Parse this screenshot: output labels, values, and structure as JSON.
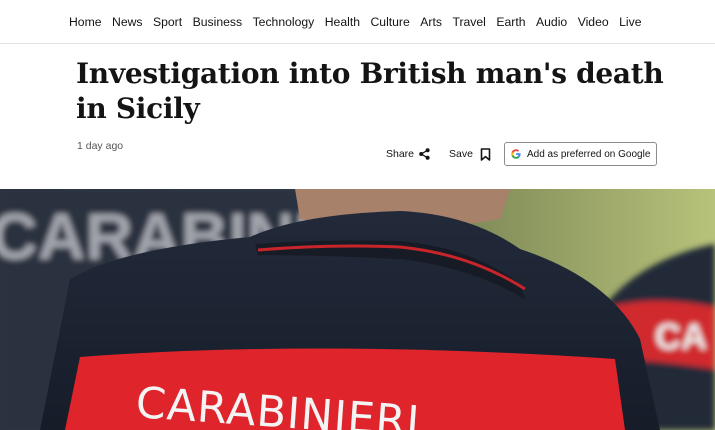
{
  "nav": {
    "items": [
      "Home",
      "News",
      "Sport",
      "Business",
      "Technology",
      "Health",
      "Culture",
      "Arts",
      "Travel",
      "Earth",
      "Audio",
      "Video",
      "Live"
    ]
  },
  "article": {
    "headline": "Investigation into British man's death in Sicily",
    "timestamp": "1 day ago"
  },
  "actions": {
    "share_label": "Share",
    "save_label": "Save",
    "preferred_label": "Add as preferred on Google",
    "share_icon": "share-icon",
    "save_icon": "bookmark-icon",
    "google_icon": "google-icon"
  },
  "hero": {
    "jacket_text": "CARABINIERI",
    "background_text": "CARABINIERI",
    "side_text": "CA",
    "colors": {
      "jacket": "#1f2634",
      "patch": "#e0242b",
      "stripe": "#c7252a",
      "grass": "#a9b96c"
    }
  }
}
